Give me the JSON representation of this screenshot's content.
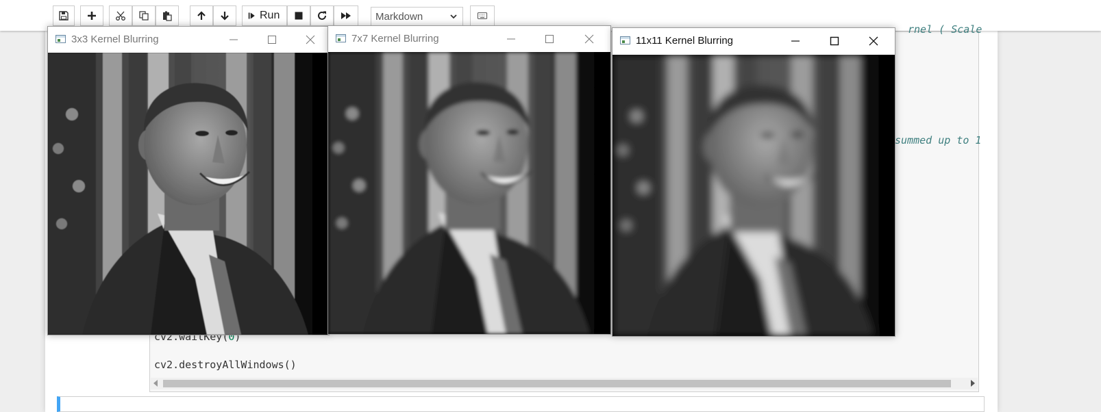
{
  "toolbar": {
    "run_label": "Run",
    "cell_type": "Markdown",
    "icons": [
      "save-icon",
      "add-cell-icon",
      "cut-icon",
      "copy-icon",
      "paste-icon",
      "move-up-icon",
      "move-down-icon",
      "run-icon",
      "stop-icon",
      "restart-icon",
      "fast-forward-icon",
      "keyboard-icon"
    ]
  },
  "code": {
    "line_partial_top": "rnel ( Scale",
    "line_partial_mid": "summed up to 1",
    "line_waitkey_fn": "cv2.waitKey(",
    "line_waitkey_arg": "0",
    "line_waitkey_end": ")",
    "line_destroy": "cv2.destroyAllWindows()"
  },
  "windows": [
    {
      "title": "3x3 Kernel Blurring",
      "blur": 0.6
    },
    {
      "title": "7x7 Kernel Blurring",
      "blur": 3
    },
    {
      "title": "11x11 Kernel Blurring",
      "blur": 5.5
    }
  ],
  "colors": {
    "accent": "#42a5f5",
    "code_bg": "#f7f7f7",
    "comment": "#408080",
    "number": "#098658"
  }
}
